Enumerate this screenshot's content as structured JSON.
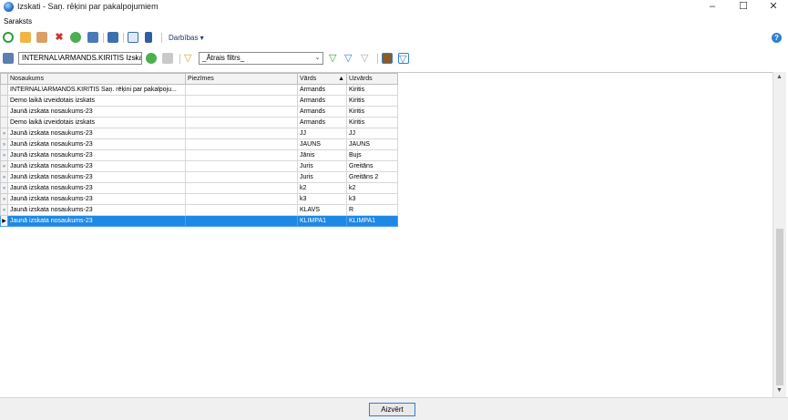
{
  "window": {
    "title": "Izskati - Saņ. rēķini par pakalpojumiem"
  },
  "menu": {
    "items": [
      "Saraksts"
    ]
  },
  "toolbar": {
    "actions_label": "Darbības ▾",
    "help": "?"
  },
  "filterbar": {
    "view_select": "INTERNAL\\ARMANDS.KIRITIS Izskat",
    "quick_filter": "_Ātrais filtrs_"
  },
  "grid": {
    "columns": [
      "Nosaukums",
      "Piezīmes",
      "Vārds",
      "Uzvārds"
    ],
    "sort_column": "Vārds",
    "sort_indicator": "▲",
    "rows": [
      {
        "indicator": "",
        "name": "INTERNAL\\ARMANDS.KIRITIS Saņ. rēķini par pakalpoju...",
        "notes": "",
        "first": "Armands",
        "last": "Kiritis"
      },
      {
        "indicator": "",
        "name": "Demo laikā izveidotais izskats",
        "notes": "",
        "first": "Armands",
        "last": "Kiritis"
      },
      {
        "indicator": "",
        "name": "Jaunā izskata nosaukums-23",
        "notes": "",
        "first": "Armands",
        "last": "Kiritis"
      },
      {
        "indicator": "",
        "name": "Demo laikā izveidotais izskats",
        "notes": "",
        "first": "Armands",
        "last": "Kiritis"
      },
      {
        "indicator": "»",
        "name": "Jaunā izskata nosaukums-23",
        "notes": "",
        "first": "JJ",
        "last": "JJ"
      },
      {
        "indicator": "»",
        "name": "Jaunā izskata nosaukums-23",
        "notes": "",
        "first": "JAUNS",
        "last": "JAUNS"
      },
      {
        "indicator": "»",
        "name": "Jaunā izskata nosaukums-23",
        "notes": "",
        "first": "Jānis",
        "last": "Bujs"
      },
      {
        "indicator": "»",
        "name": "Jaunā izskata nosaukums-23",
        "notes": "",
        "first": "Juris",
        "last": "Greitāns"
      },
      {
        "indicator": "»",
        "name": "Jaunā izskata nosaukums-23",
        "notes": "",
        "first": "Juris",
        "last": "Greitāns 2"
      },
      {
        "indicator": "»",
        "name": "Jaunā izskata nosaukums-23",
        "notes": "",
        "first": "k2",
        "last": "k2"
      },
      {
        "indicator": "»",
        "name": "Jaunā izskata nosaukums-23",
        "notes": "",
        "first": "k3",
        "last": "k3"
      },
      {
        "indicator": "»",
        "name": "Jaunā izskata nosaukums-23",
        "notes": "",
        "first": "KLAVS",
        "last": "R"
      },
      {
        "indicator": "▶",
        "name": "Jaunā izskata nosaukums-23",
        "notes": "",
        "first": "KLIMPA1",
        "last": "KLIMPA1",
        "selected": true
      }
    ]
  },
  "footer": {
    "close_label": "Aizvērt"
  }
}
